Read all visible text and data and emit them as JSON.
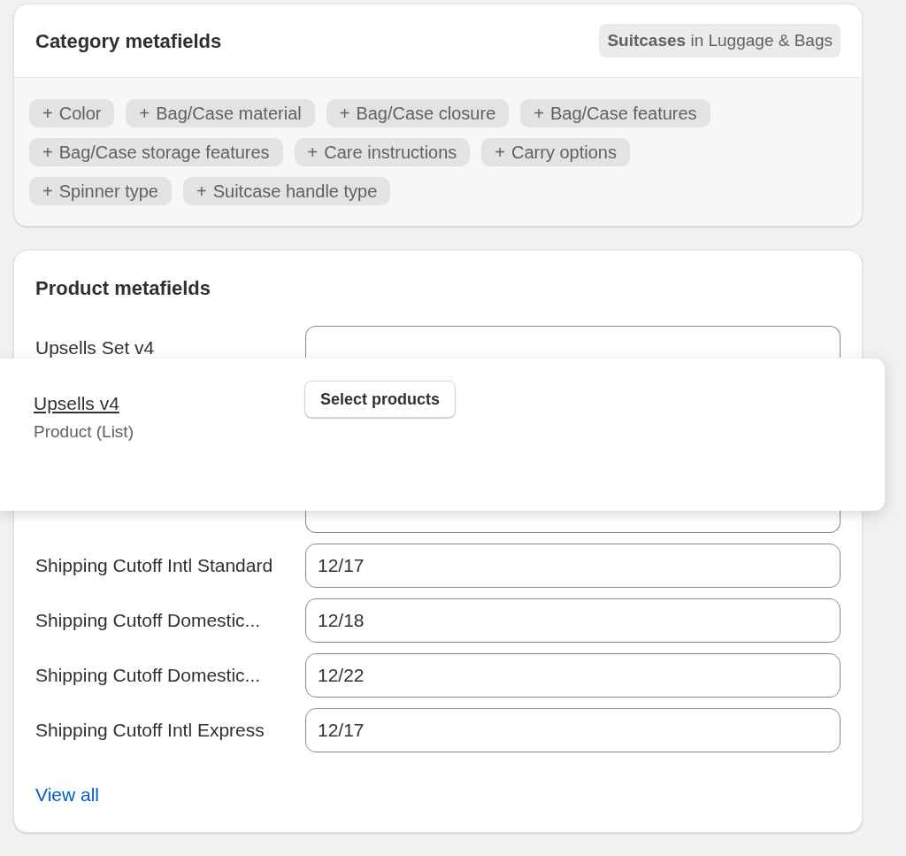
{
  "category_card": {
    "title": "Category metafields",
    "category_badge": "**Suitcases** in Luggage & Bags",
    "chips": [
      {
        "icon": "+",
        "label": "Color"
      },
      {
        "icon": "+",
        "label": "Bag/Case material"
      },
      {
        "icon": "+",
        "label": "Bag/Case closure"
      },
      {
        "icon": "+",
        "label": "Bag/Case features"
      },
      {
        "icon": "+",
        "label": "Bag/Case storage features"
      },
      {
        "icon": "+",
        "label": "Care instructions"
      },
      {
        "icon": "+",
        "label": "Carry options"
      },
      {
        "icon": "+",
        "label": "Spinner type"
      },
      {
        "icon": "+",
        "label": "Suitcase handle type"
      }
    ]
  },
  "product_card": {
    "title": "Product metafields",
    "fields_top": [
      {
        "label": "Upsells Set v4"
      }
    ],
    "fields_bottom": [
      {
        "label": "Shipping Cutoff Intl Standard",
        "value": "12/17"
      },
      {
        "label": "Shipping Cutoff Domestic...",
        "value": "12/18"
      },
      {
        "label": "Shipping Cutoff Domestic...",
        "value": "12/22"
      },
      {
        "label": "Shipping Cutoff Intl Express",
        "value": "12/17"
      }
    ],
    "view_all": "View all"
  },
  "dragged_row": {
    "label": "Upsells v4",
    "type": "Product (List)",
    "button": "Select products"
  }
}
